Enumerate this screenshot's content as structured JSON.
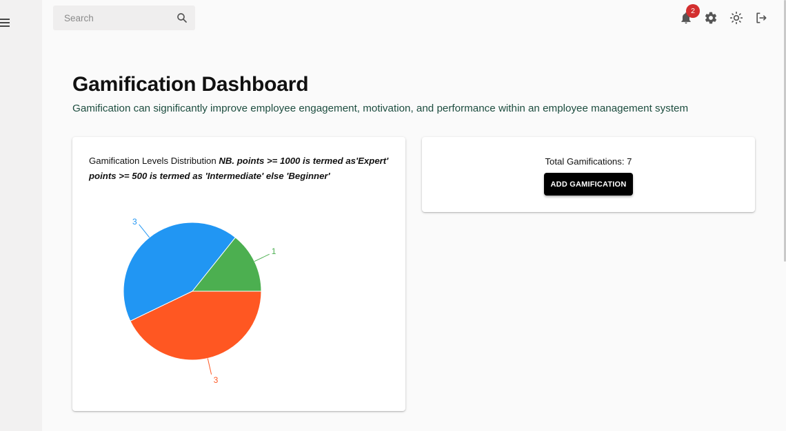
{
  "header": {
    "search_placeholder": "Search",
    "notification_count": "2",
    "icons": [
      "menu-icon",
      "search-icon",
      "bell-icon",
      "gear-icon",
      "sun-icon",
      "logout-icon"
    ]
  },
  "page": {
    "title": "Gamification Dashboard",
    "subtitle": "Gamification can significantly improve employee engagement, motivation, and performance within an employee management system"
  },
  "chart_card": {
    "caption_plain": "Gamification Levels Distribution ",
    "caption_note": "NB. points >= 1000 is termed as'Expert' points >= 500 is termed as 'Intermediate' else 'Beginner'"
  },
  "summary_card": {
    "total_text": "Total Gamifications: 7",
    "add_button_label": "ADD GAMIFICATION"
  },
  "chart_data": {
    "type": "pie",
    "title": "",
    "slices": [
      {
        "label": "1",
        "value": 1,
        "color": "#4caf50"
      },
      {
        "label": "3",
        "value": 3,
        "color": "#2196f3"
      },
      {
        "label": "3",
        "value": 3,
        "color": "#ff5722"
      }
    ]
  }
}
